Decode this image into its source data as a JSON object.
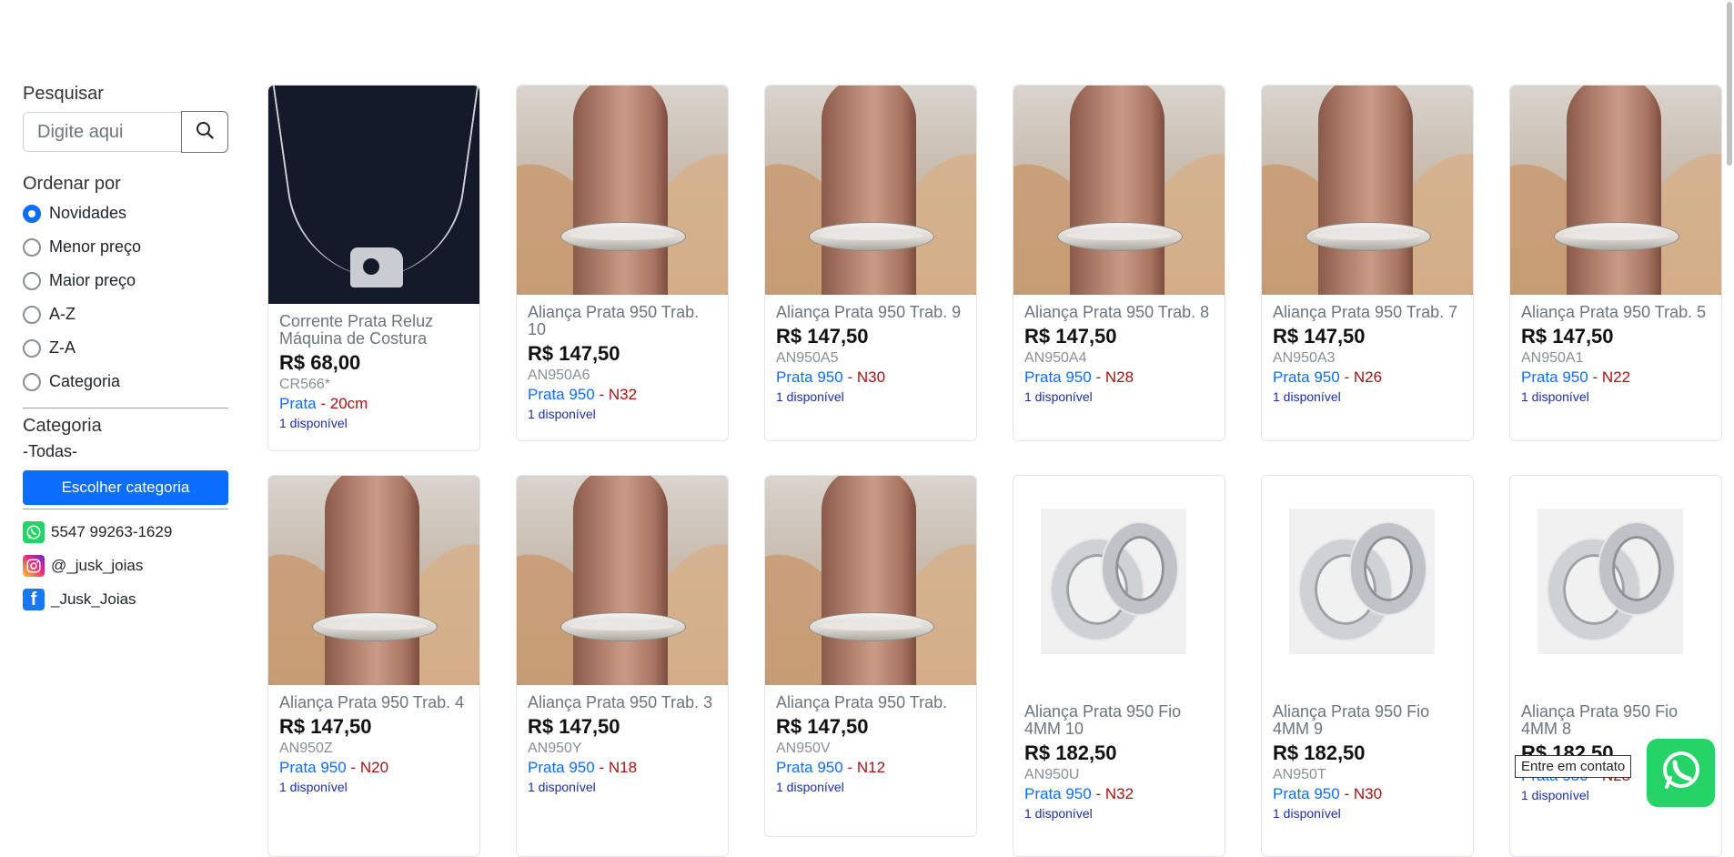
{
  "sidebar": {
    "search": {
      "heading": "Pesquisar",
      "placeholder": "Digite aqui",
      "value": ""
    },
    "sort": {
      "heading": "Ordenar por",
      "selected": "Novidades",
      "options": [
        "Novidades",
        "Menor preço",
        "Maior preço",
        "A-Z",
        "Z-A",
        "Categoria"
      ]
    },
    "category": {
      "heading": "Categoria",
      "current": "-Todas-",
      "button_label": "Escolher categoria"
    },
    "contacts": [
      {
        "icon": "whatsapp-icon",
        "label": "5547 99263-1629"
      },
      {
        "icon": "instagram-icon",
        "label": "@_jusk_joias"
      },
      {
        "icon": "facebook-icon",
        "label": "_Jusk_Joias"
      }
    ]
  },
  "products": [
    {
      "title": "Corrente Prata Reluz Máquina de Costura",
      "price": "R$ 68,00",
      "sku": "CR566*",
      "material": "Prata",
      "size": "20cm",
      "availability": "1 disponível",
      "photo": "necklace"
    },
    {
      "title": "Aliança Prata 950 Trab. 10",
      "price": "R$ 147,50",
      "sku": "AN950A6",
      "material": "Prata 950",
      "size": "N32",
      "availability": "1 disponível",
      "photo": "hand"
    },
    {
      "title": "Aliança Prata 950 Trab. 9",
      "price": "R$ 147,50",
      "sku": "AN950A5",
      "material": "Prata 950",
      "size": "N30",
      "availability": "1 disponível",
      "photo": "hand"
    },
    {
      "title": "Aliança Prata 950 Trab. 8",
      "price": "R$ 147,50",
      "sku": "AN950A4",
      "material": "Prata 950",
      "size": "N28",
      "availability": "1 disponível",
      "photo": "hand"
    },
    {
      "title": "Aliança Prata 950 Trab. 7",
      "price": "R$ 147,50",
      "sku": "AN950A3",
      "material": "Prata 950",
      "size": "N26",
      "availability": "1 disponível",
      "photo": "hand"
    },
    {
      "title": "Aliança Prata 950 Trab. 5",
      "price": "R$ 147,50",
      "sku": "AN950A1",
      "material": "Prata 950",
      "size": "N22",
      "availability": "1 disponível",
      "photo": "hand"
    },
    {
      "title": "Aliança Prata 950 Trab. 4",
      "price": "R$ 147,50",
      "sku": "AN950Z",
      "material": "Prata 950",
      "size": "N20",
      "availability": "1 disponível",
      "photo": "hand"
    },
    {
      "title": "Aliança Prata 950 Trab. 3",
      "price": "R$ 147,50",
      "sku": "AN950Y",
      "material": "Prata 950",
      "size": "N18",
      "availability": "1 disponível",
      "photo": "hand"
    },
    {
      "title": "Aliança Prata 950 Trab.",
      "price": "R$ 147,50",
      "sku": "AN950V",
      "material": "Prata 950",
      "size": "N12",
      "availability": "1 disponível",
      "photo": "hand"
    },
    {
      "title": "Aliança Prata 950 Fio 4MM 10",
      "price": "R$ 182,50",
      "sku": "AN950U",
      "material": "Prata 950",
      "size": "N32",
      "availability": "1 disponível",
      "photo": "rings"
    },
    {
      "title": "Aliança Prata 950 Fio 4MM 9",
      "price": "R$ 182,50",
      "sku": "AN950T",
      "material": "Prata 950",
      "size": "N30",
      "availability": "1 disponível",
      "photo": "rings"
    },
    {
      "title": "Aliança Prata 950 Fio 4MM 8",
      "price": "R$ 182,50",
      "sku": "",
      "material": "Prata 950",
      "size": "N28",
      "availability": "1 disponível",
      "photo": "rings"
    }
  ],
  "floating": {
    "tooltip": "Entre em contato",
    "icon": "whatsapp-icon",
    "color": "#25d366"
  },
  "colors": {
    "primary": "#0d6efd",
    "size_text": "#aa1111",
    "availability": "#1c2fa6"
  }
}
